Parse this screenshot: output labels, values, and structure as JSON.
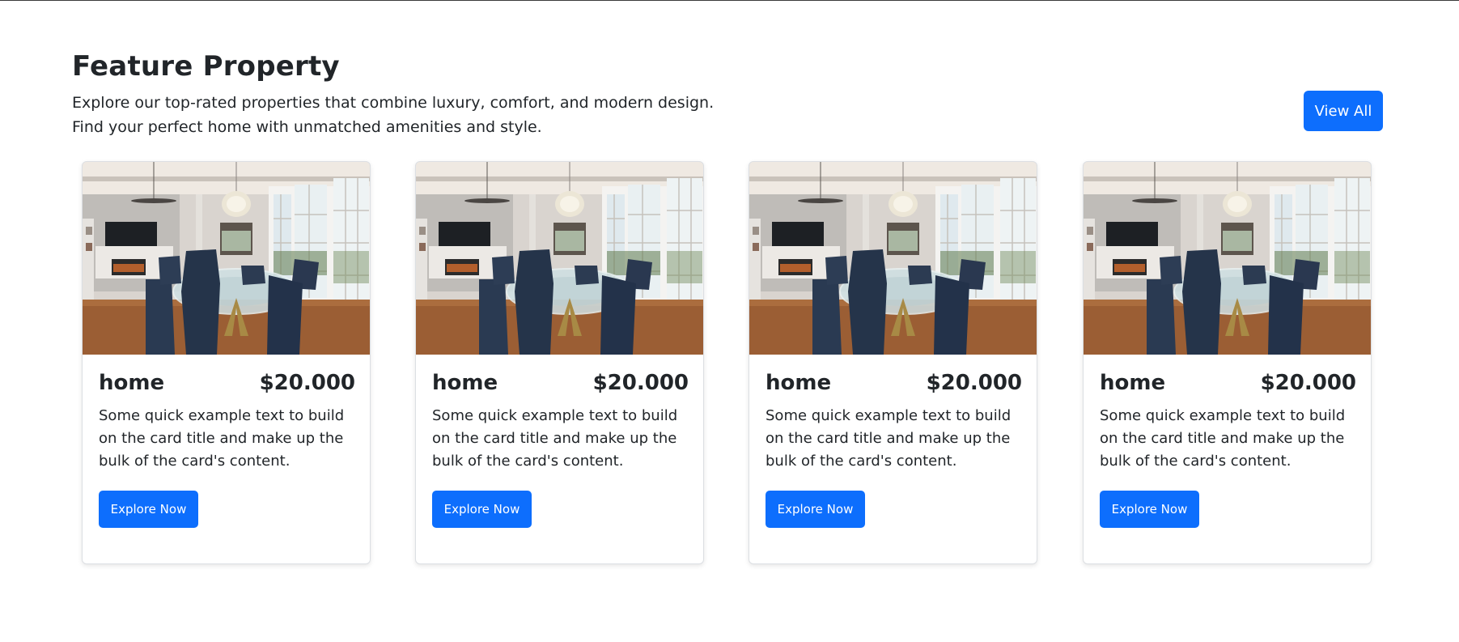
{
  "section": {
    "title": "Feature Property",
    "description": "Explore our top-rated properties that combine luxury, comfort, and modern design. Find your perfect home with unmatched amenities and style.",
    "view_all_label": "View All"
  },
  "cards": [
    {
      "title": "home",
      "price": "$20.000",
      "text": "Some quick example text to build on the card title and make up the bulk of the card's content.",
      "button_label": "Explore Now"
    },
    {
      "title": "home",
      "price": "$20.000",
      "text": "Some quick example text to build on the card title and make up the bulk of the card's content.",
      "button_label": "Explore Now"
    },
    {
      "title": "home",
      "price": "$20.000",
      "text": "Some quick example text to build on the card title and make up the bulk of the card's content.",
      "button_label": "Explore Now"
    },
    {
      "title": "home",
      "price": "$20.000",
      "text": "Some quick example text to build on the card title and make up the bulk of the card's content.",
      "button_label": "Explore Now"
    }
  ],
  "colors": {
    "accent": "#0d6efd",
    "text": "#212529"
  }
}
